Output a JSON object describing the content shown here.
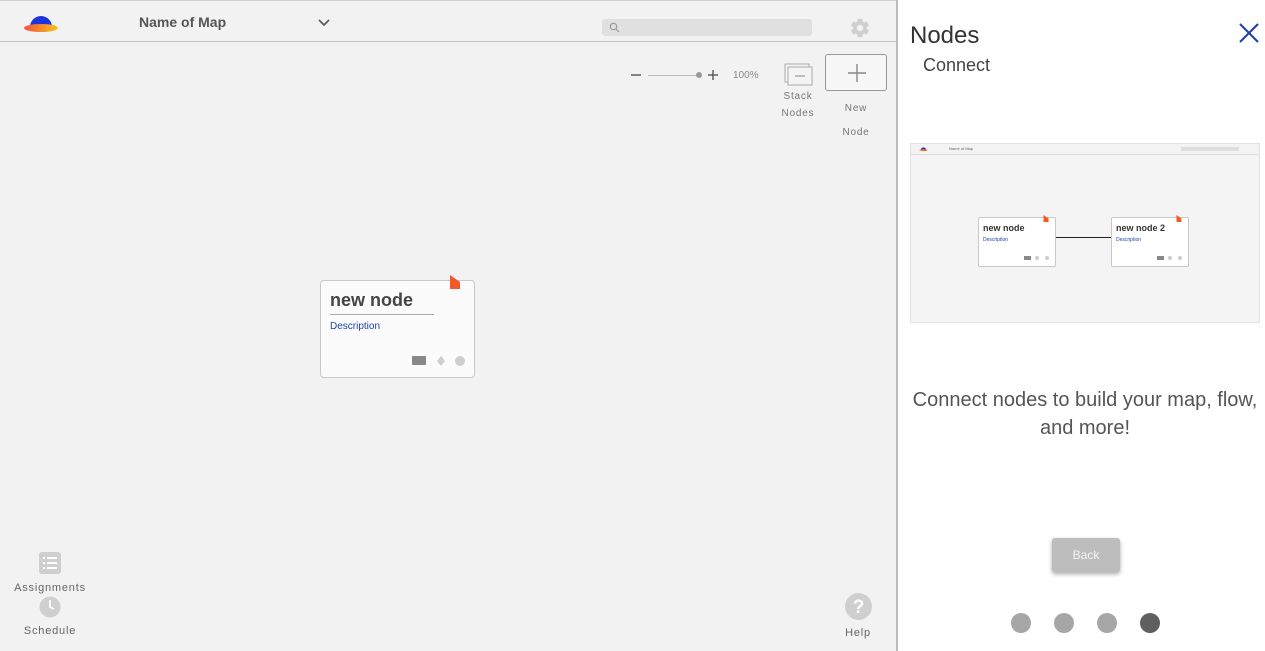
{
  "header": {
    "map_title": "Name of Map",
    "search_placeholder": "",
    "icons": [
      "app-logo-icon",
      "chevron-down-icon",
      "search-icon",
      "gear-icon"
    ]
  },
  "toolbar": {
    "zoom_level": "100%",
    "stack_nodes_label_line1": "Stack",
    "stack_nodes_label_line2": "Nodes",
    "new_node_label_line1": "New",
    "new_node_label_line2": "Node"
  },
  "node": {
    "title": "new node",
    "description": "Description",
    "flag_color": "#f05a28"
  },
  "nav": {
    "assignments_label": "Assignments",
    "schedule_label": "Schedule",
    "help_label": "Help"
  },
  "panel": {
    "title": "Nodes",
    "subtitle": "Connect",
    "message": "Connect nodes to build your map, flow, and more!",
    "back_label": "Back",
    "page_count": 4,
    "current_page": 4,
    "preview": {
      "map_title": "Name of Map",
      "node1_title": "new node",
      "node1_description": "Description",
      "node2_title": "new node 2",
      "node2_description": "Description"
    }
  },
  "colors": {
    "accent_blue": "#2041b0",
    "flag_orange": "#f05a28",
    "close_blue": "#1e3fa8"
  }
}
